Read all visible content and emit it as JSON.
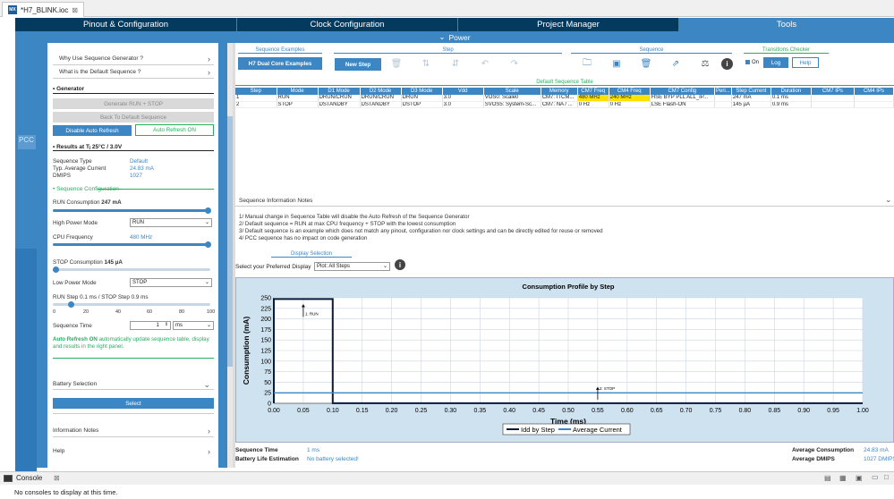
{
  "editor_tab": {
    "title": "*H7_BLINK.ioc",
    "close": "⊠",
    "icon_text": "MX"
  },
  "topnav": {
    "tabs": [
      "Pinout & Configuration",
      "Clock Configuration",
      "Project Manager",
      "Tools"
    ],
    "active": 3
  },
  "powerbar": {
    "label": "Power"
  },
  "leftstrip": {
    "label": "PCC"
  },
  "left": {
    "faq1": "Why Use Sequence Generator ?",
    "faq2": "What is the Default Sequence ?",
    "generator_title": "• Generator",
    "gen_run_stop": "Generate RUN + STOP",
    "back_default": "Back To Default Sequence",
    "disable_auto": "Disable Auto Refresh",
    "auto_on": "Auto Refresh ON",
    "results_title": "• Results at Tⱼ 25°C / 3.0V",
    "seq_type_k": "Sequence Type",
    "seq_type_v": "Default",
    "avg_cur_k": "Typ. Average Current",
    "avg_cur_v": "24.83 mA",
    "dmips_k": "DMIPS",
    "dmips_v": "1027",
    "seqconf_title": "• Sequence Configuration",
    "run_cons": "RUN Consumption",
    "run_cons_v": "247 mA",
    "hpm_k": "High Power Mode",
    "hpm_v": "RUN",
    "cpu_k": "CPU Frequency",
    "cpu_v": "480 MHz",
    "stop_cons": "STOP Consumption",
    "stop_cons_v": "145 µA",
    "lpm_k": "Low Power Mode",
    "lpm_v": "STOP",
    "runstep": "RUN Step 0.1 ms / STOP Step 0.9 ms",
    "ticks": [
      "0",
      "20",
      "40",
      "60",
      "80",
      "100"
    ],
    "runstep_value": 10,
    "seqtime_k": "Sequence Time",
    "seqtime_v": "1",
    "seqtime_unit": "ms",
    "auto_note_b": "Auto Refresh ON",
    "auto_note": " automatically update sequence table, display and results in the right panel.",
    "battery": "Battery Selection",
    "select": "Select",
    "info_notes": "Information Notes",
    "help": "Help"
  },
  "toolbar": {
    "g_examples": "Sequence Examples",
    "g_step": "Step",
    "g_sequence": "Sequence",
    "g_transitions": "Transitions Checker",
    "h7_btn": "H7 Dual Core Examples",
    "new_step": "New Step",
    "on": "On",
    "log": "Log",
    "help": "Help"
  },
  "table": {
    "title": "Default Sequence Table",
    "headers": [
      "Step",
      "Mode",
      "D1 Mode",
      "D2 Mode",
      "D3 Mode",
      "Vdd",
      "Scale",
      "Memory",
      "CM7 Freq",
      "CM4 Freq",
      "CM7 Config",
      "Peri...",
      "Step Current",
      "Duration",
      "CM7 IPs",
      "CM4 IPs"
    ],
    "rows": [
      [
        "1",
        "RUN",
        "DRUN/CRUN",
        "DRUN/CRUN",
        "DRUN",
        "3.0",
        "VOS0: Scale0",
        "CM7: ITCM...",
        "480 MHz",
        "240 MHz",
        "HSE BYP PLL ALL_IP...",
        "",
        "247 mA",
        "0.1 ms",
        "",
        ""
      ],
      [
        "2",
        "STOP",
        "DSTANDBY",
        "DSTANDBY",
        "DSTOP",
        "3.0",
        "SVOS5: System-Sc...",
        "CM7: NA / ...",
        "0 Hz",
        "0 Hz",
        "LSE Flash-ON",
        "",
        "145 µA",
        "0.9 ms",
        "",
        ""
      ]
    ]
  },
  "notes": {
    "title": "Sequence Information Notes",
    "lines": [
      "1/ Manual change in Sequence Table will disable the Auto Refresh of the Sequence Generator",
      "2/ Default sequence = RUN at max CPU frequency + STOP with the lowest consumption",
      "3/ Default sequence is an example which does not match any pinout, configuration nor clock settings and can be directly edited for reuse or removed",
      "4/ PCC sequence has no impact on code generation"
    ]
  },
  "display": {
    "title": "Display Selection",
    "label": "Select your Preferred Display",
    "value": "Plot: All Steps"
  },
  "chart_data": {
    "type": "line",
    "title": "Consumption Profile by Step",
    "xlabel": "Time (ms)",
    "ylabel": "Consumption (mA)",
    "xlim": [
      0,
      1.0
    ],
    "ylim": [
      0,
      250
    ],
    "xticks": [
      "0.00",
      "0.05",
      "0.10",
      "0.15",
      "0.20",
      "0.25",
      "0.30",
      "0.35",
      "0.40",
      "0.45",
      "0.50",
      "0.55",
      "0.60",
      "0.65",
      "0.70",
      "0.75",
      "0.80",
      "0.85",
      "0.90",
      "0.95",
      "1.00"
    ],
    "yticks": [
      "0",
      "25",
      "50",
      "75",
      "100",
      "125",
      "150",
      "175",
      "200",
      "225",
      "250"
    ],
    "series": [
      {
        "name": "Idd by Step",
        "color": "#0a1a3a",
        "x": [
          0,
          0,
          0.1,
          0.1,
          1.0
        ],
        "y": [
          0,
          247,
          247,
          0.145,
          0.145
        ]
      },
      {
        "name": "Average Current",
        "color": "#3c86c4",
        "x": [
          0,
          1.0
        ],
        "y": [
          24.83,
          24.83
        ]
      }
    ],
    "annotations": [
      {
        "x": 0.05,
        "y": 247,
        "text": "1: RUN"
      },
      {
        "x": 0.55,
        "y": 0.145,
        "text": "2: STOP"
      }
    ],
    "legend": "bottom",
    "grid": true
  },
  "footer": {
    "seqtime_k": "Sequence Time",
    "seqtime_v": "1 ms",
    "batt_k": "Battery Life Estimation",
    "batt_v": "No battery selected!",
    "avgcons_k": "Average Consumption",
    "avgcons_v": "24.83 mA",
    "avgdmips_k": "Average DMIPS",
    "avgdmips_v": "1027 DMIPS"
  },
  "console": {
    "tab": "Console",
    "close": "⊠",
    "status": "No consoles to display at this time."
  }
}
